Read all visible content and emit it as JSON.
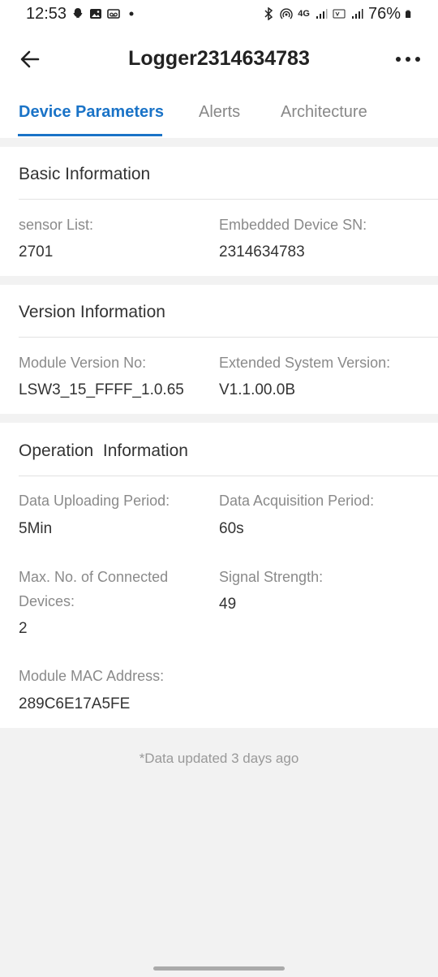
{
  "status_bar": {
    "time": "12:53",
    "network": "4G",
    "battery": "76%"
  },
  "header": {
    "title": "Logger2314634783"
  },
  "tabs": [
    {
      "label": "Device Parameters",
      "active": true
    },
    {
      "label": "Alerts",
      "active": false
    },
    {
      "label": "Architecture",
      "active": false
    }
  ],
  "basic_info": {
    "title": "Basic Information",
    "sensor_list_label": "sensor List:",
    "sensor_list_value": "2701",
    "embedded_sn_label": "Embedded Device SN:",
    "embedded_sn_value": "2314634783"
  },
  "version_info": {
    "title": "Version Information",
    "module_version_label": "Module Version No:",
    "module_version_value": "LSW3_15_FFFF_1.0.65",
    "extended_version_label": "Extended System Version:",
    "extended_version_value": "V1.1.00.0B"
  },
  "operation_info": {
    "title": "Operation  Information",
    "upload_period_label": "Data Uploading Period:",
    "upload_period_value": "5Min",
    "acquisition_period_label": "Data Acquisition Period:",
    "acquisition_period_value": "60s",
    "max_devices_label_line1": "Max. No. of Connected",
    "max_devices_label_line2": "Devices:",
    "max_devices_value": "2",
    "signal_strength_label": "Signal Strength:",
    "signal_strength_value": "49",
    "mac_label": "Module MAC Address:",
    "mac_value": "289C6E17A5FE"
  },
  "footer": {
    "note": "*Data updated 3 days ago"
  },
  "colors": {
    "accent": "#1a73c7",
    "background": "#f2f2f2"
  }
}
